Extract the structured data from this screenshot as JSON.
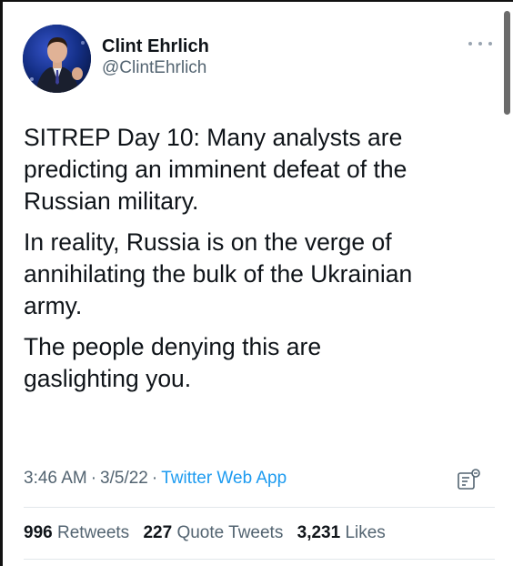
{
  "author": {
    "display_name": "Clint Ehrlich",
    "handle": "@ClintEhrlich"
  },
  "tweet": {
    "paragraphs": [
      "SITREP Day 10: Many analysts are\npredicting an imminent defeat of the\nRussian military.",
      "In reality, Russia is on the verge of\nannihilating the bulk of the Ukrainian\narmy.",
      "The people denying this are\ngaslighting you."
    ]
  },
  "meta": {
    "time": "3:46 AM",
    "separator": "·",
    "date": "3/5/22",
    "source": "Twitter Web App"
  },
  "stats": {
    "retweets_count": "996",
    "retweets_label": "Retweets",
    "quotes_count": "227",
    "quotes_label": "Quote Tweets",
    "likes_count": "3,231",
    "likes_label": "Likes"
  },
  "icons": {
    "more": "more-horizontal-icon",
    "analytics": "analytics-icon"
  },
  "colors": {
    "text": "#0f1419",
    "secondary": "#536471",
    "link": "#1d9bf0",
    "divider": "#e2e7eb"
  }
}
